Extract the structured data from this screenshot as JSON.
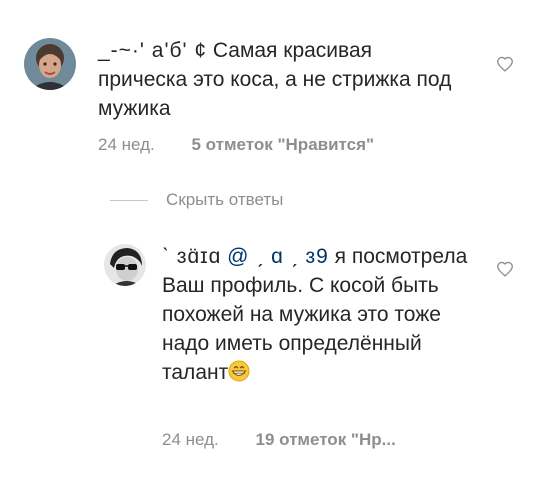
{
  "comments": [
    {
      "username": "_-~·' а'б' ¢",
      "text": "Самая красивая прическа это коса, а не стрижка под мужика",
      "time": "24 нед.",
      "likes": "5 отметок \"Нравится\""
    },
    {
      "username": "ˋ ɜɑ̈ɪɑ",
      "mention": "@ ˏ ɑ ˏ ɜ9",
      "text": "я посмотрела Ваш профиль. С косой быть похожей на мужика это тоже надо иметь определённый талант",
      "emoji": "grinning-face-emoji",
      "time": "24 нед.",
      "likes": "19 отметок \"Нр..."
    }
  ],
  "replies_toggle": "Скрыть ответы",
  "icons": {
    "like": "heart-outline-icon"
  },
  "colors": {
    "text": "#262626",
    "muted": "#8e8e8e",
    "divider": "#c7c7c7"
  }
}
